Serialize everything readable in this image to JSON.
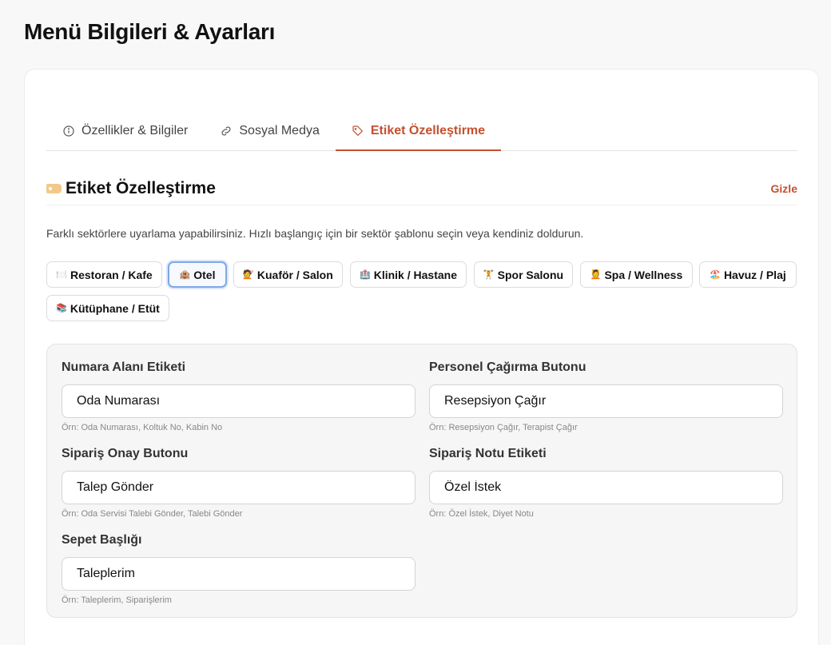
{
  "page": {
    "title": "Menü Bilgileri & Ayarları"
  },
  "tabs": [
    {
      "label": "Özellikler & Bilgiler",
      "icon": "info-icon"
    },
    {
      "label": "Sosyal Medya",
      "icon": "link-icon"
    },
    {
      "label": "Etiket Özelleştirme",
      "icon": "tag-icon",
      "active": true
    }
  ],
  "section": {
    "title": "Etiket Özelleştirme",
    "hide_label": "Gizle",
    "description": "Farklı sektörlere uyarlama yapabilirsiniz. Hızlı başlangıç için bir sektör şablonu seçin veya kendiniz doldurun."
  },
  "presets": [
    {
      "emoji": "🍽️",
      "label": "Restoran / Kafe"
    },
    {
      "emoji": "🏨",
      "label": "Otel",
      "active": true
    },
    {
      "emoji": "💇",
      "label": "Kuaför / Salon"
    },
    {
      "emoji": "🏥",
      "label": "Klinik / Hastane"
    },
    {
      "emoji": "🏋️",
      "label": "Spor Salonu"
    },
    {
      "emoji": "💆",
      "label": "Spa / Wellness"
    },
    {
      "emoji": "🏖️",
      "label": "Havuz / Plaj"
    },
    {
      "emoji": "📚",
      "label": "Kütüphane / Etüt"
    }
  ],
  "fields": {
    "number_label": {
      "label": "Numara Alanı Etiketi",
      "value": "Oda Numarası",
      "hint": "Örn: Oda Numarası, Koltuk No, Kabin No"
    },
    "call_staff": {
      "label": "Personel Çağırma Butonu",
      "value": "Resepsiyon Çağır",
      "hint": "Örn: Resepsiyon Çağır, Terapist Çağır"
    },
    "order_confirm": {
      "label": "Sipariş Onay Butonu",
      "value": "Talep Gönder",
      "hint": "Örn: Oda Servisi Talebi Gönder, Talebi Gönder"
    },
    "order_note": {
      "label": "Sipariş Notu Etiketi",
      "value": "Özel İstek",
      "hint": "Örn: Özel İstek, Diyet Notu"
    },
    "cart_title": {
      "label": "Sepet Başlığı",
      "value": "Taleplerim",
      "hint": "Örn: Taleplerim, Siparişlerim"
    }
  },
  "colors": {
    "accent": "#c4502f",
    "active_chip_border": "#7fa8e6"
  }
}
